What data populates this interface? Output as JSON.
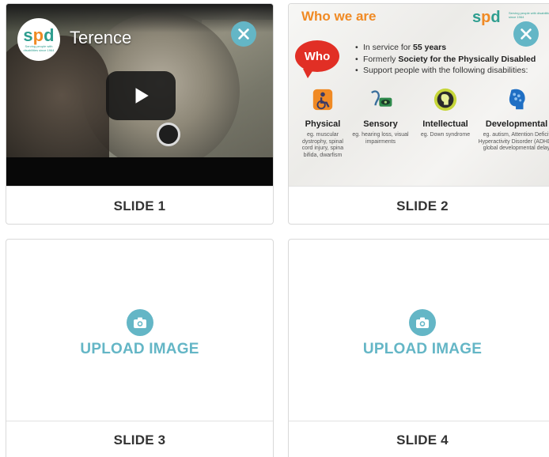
{
  "slides": [
    {
      "caption": "SLIDE 1",
      "video": {
        "title": "Terence",
        "logo_text_a": "s",
        "logo_text_b": "p",
        "logo_text_c": "d",
        "logo_tagline": "Serving people with disabilities since 1964"
      }
    },
    {
      "caption": "SLIDE 2",
      "content": {
        "heading": "Who we are",
        "logo_text_a": "s",
        "logo_text_b": "p",
        "logo_text_c": "d",
        "logo_tagline": "Serving people with disabilities since 1964",
        "bubble": "Who",
        "bullets": [
          {
            "pre": "In service for ",
            "bold": "55 years",
            "post": ""
          },
          {
            "pre": "Formerly ",
            "bold": "Society for the Physically Disabled",
            "post": ""
          },
          {
            "pre": "Support people with the following disabilities:",
            "bold": "",
            "post": ""
          }
        ],
        "categories": [
          {
            "name": "Physical",
            "examples": "eg. muscular dystrophy, spinal cord injury, spina bifida, dwarfism",
            "icon": "wheelchair-icon"
          },
          {
            "name": "Sensory",
            "examples": "eg. hearing loss, visual impairments",
            "icon": "ear-eye-icon"
          },
          {
            "name": "Intellectual",
            "examples": "eg. Down syndrome",
            "icon": "head-icon"
          },
          {
            "name": "Developmental",
            "examples": "eg. autism, Attention Deficit Hyperactivity Disorder (ADHD), global developmental delay",
            "icon": "brain-head-icon"
          }
        ]
      }
    },
    {
      "caption": "SLIDE 3",
      "upload_label": "UPLOAD IMAGE"
    },
    {
      "caption": "SLIDE 4",
      "upload_label": "UPLOAD IMAGE"
    }
  ],
  "colors": {
    "accent": "#64b6c6",
    "orange": "#f08a24",
    "teal": "#2e9e8f",
    "red": "#e12f25"
  },
  "icons": {
    "close": "close-icon",
    "play": "play-icon",
    "camera": "camera-icon"
  }
}
